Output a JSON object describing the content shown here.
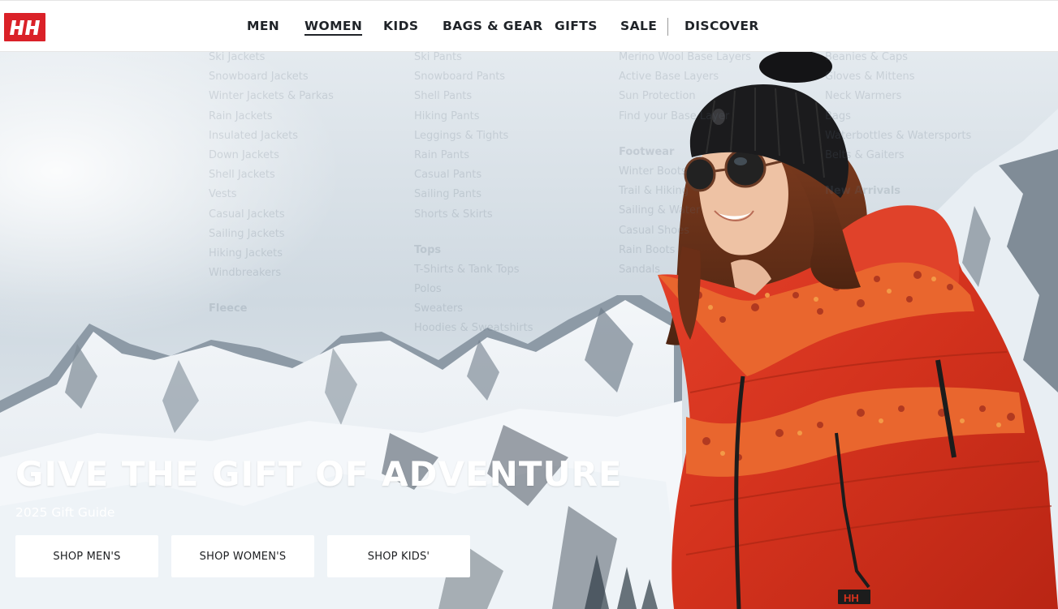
{
  "brand": {
    "logo_text": "HH",
    "color": "#da2128"
  },
  "nav": {
    "items": [
      "MEN",
      "WOMEN",
      "KIDS",
      "BAGS & GEAR",
      "GIFTS",
      "SALE",
      "DISCOVER"
    ],
    "active": "WOMEN"
  },
  "menu_ghost": {
    "col1": [
      "Ski Jackets",
      "Snowboard Jackets",
      "Winter Jackets & Parkas",
      "Rain Jackets",
      "Insulated Jackets",
      "Down Jackets",
      "Shell Jackets",
      "Vests",
      "Casual Jackets",
      "Sailing Jackets",
      "Hiking Jackets",
      "Windbreakers"
    ],
    "col1_heading": "Fleece",
    "col2": [
      "Ski Pants",
      "Snowboard Pants",
      "Shell Pants",
      "Hiking Pants",
      "Leggings & Tights",
      "Rain Pants",
      "Casual Pants",
      "Sailing Pants",
      "Shorts & Skirts"
    ],
    "col2_heading": "Tops",
    "col2b": [
      "T-Shirts & Tank Tops",
      "Polos",
      "Sweaters",
      "Hoodies & Sweatshirts"
    ],
    "col3": [
      "Merino Wool Base Layers",
      "Active Base Layers",
      "Sun Protection",
      "Find your Base Layer"
    ],
    "col3_heading": "Footwear",
    "col3b": [
      "Winter Boots",
      "Trail & Hiking",
      "Sailing & Water",
      "Casual Shoes",
      "Rain Boots",
      "Sandals"
    ],
    "col4": [
      "Beanies & Caps",
      "Gloves & Mittens",
      "Neck Warmers",
      "Bags",
      "Waterbottles & Watersports",
      "Belts & Gaiters"
    ],
    "col4_heading": "New Arrivals"
  },
  "hero": {
    "headline": "GIVE THE GIFT OF ADVENTURE",
    "subheadline": "2025 Gift Guide",
    "buttons": [
      "SHOP MEN'S",
      "SHOP WOMEN'S",
      "SHOP KIDS'"
    ]
  },
  "colors": {
    "text_dark": "#1f2328",
    "jacket_red": "#d8321c",
    "sky": "#dfe6ec"
  }
}
